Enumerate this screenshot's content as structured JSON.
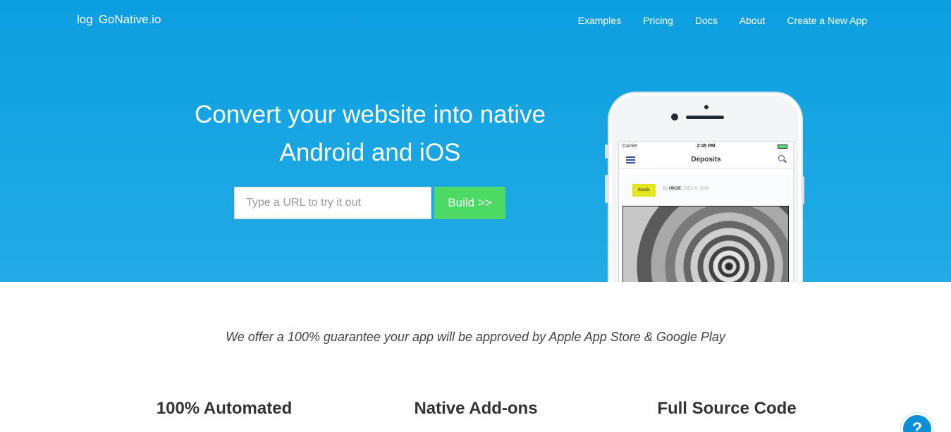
{
  "brand": {
    "logo_alt": "log",
    "name": "GoNative.io"
  },
  "nav": {
    "items": [
      {
        "label": "Examples"
      },
      {
        "label": "Pricing"
      },
      {
        "label": "Docs"
      },
      {
        "label": "About"
      },
      {
        "label": "Create a New App"
      }
    ]
  },
  "hero": {
    "headline_line1": "Convert your website into native",
    "headline_line2": "Android and iOS",
    "url_placeholder": "Type a URL to try it out",
    "build_label": "Build >>"
  },
  "phone": {
    "carrier": "Carrier",
    "time": "2:45 PM",
    "app_title": "Deposits",
    "tag": "fossils",
    "author_prefix": "By",
    "author": "UKGE",
    "date": "/ DEC 8, 2016"
  },
  "guarantee": "We offer a 100% guarantee your app will be approved by Apple App Store & Google Play",
  "features": [
    {
      "title": "100% Automated"
    },
    {
      "title": "Native Add-ons"
    },
    {
      "title": "Full Source Code"
    }
  ],
  "help": {
    "label": "?"
  },
  "colors": {
    "hero_blue": "#0c9fe0",
    "build_green": "#4cd964",
    "tag_yellow": "#e4e61b"
  }
}
